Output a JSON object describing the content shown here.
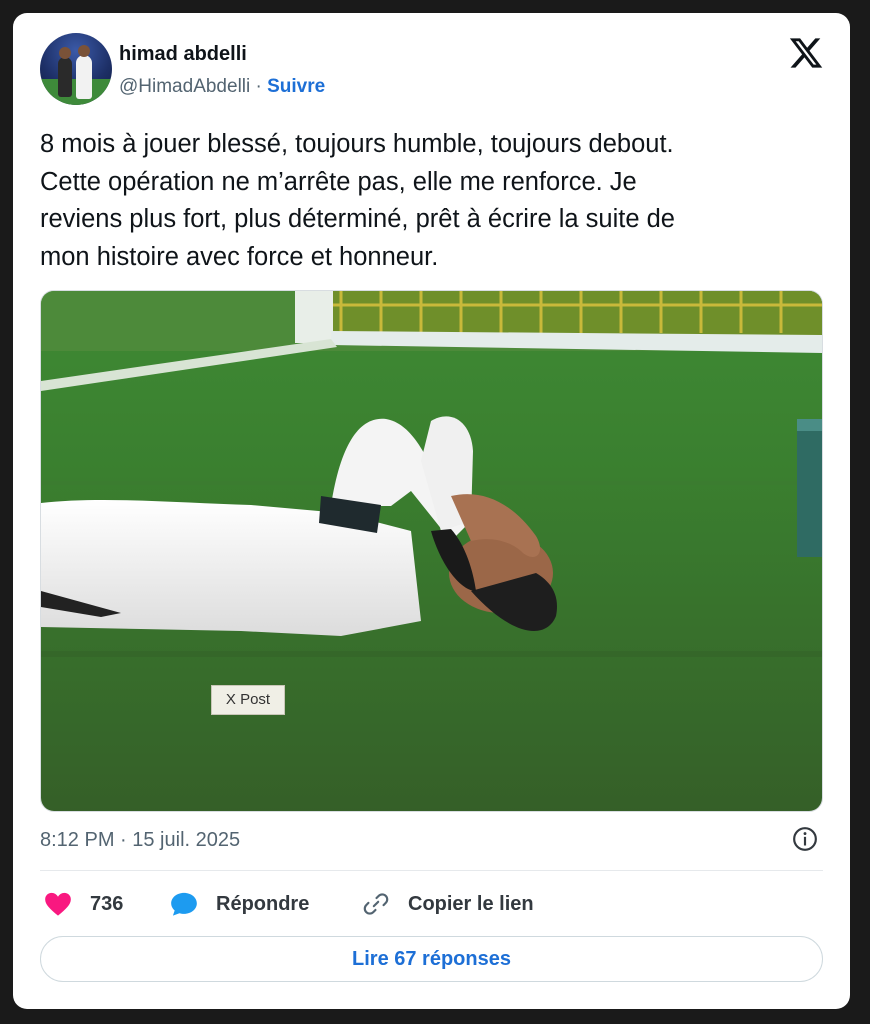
{
  "author": {
    "name": "himad abdelli",
    "handle": "@HimadAbdelli",
    "separator": "·",
    "follow_label": "Suivre"
  },
  "tweet": {
    "lines": [
      "8 mois à jouer blessé, toujours humble, toujours debout.",
      "Cette opération ne m’arrête pas, elle me renforce. Je",
      "reviens plus fort, plus déterminé, prêt à écrire la suite de",
      "mon histoire avec force et honneur."
    ]
  },
  "media": {
    "overlay_tag": "X Post"
  },
  "meta": {
    "timestamp": "8:12 PM · 15 juil. 2025"
  },
  "actions": {
    "like_count": "736",
    "reply_label": "Répondre",
    "copy_link_label": "Copier le lien"
  },
  "footer": {
    "read_replies_label": "Lire 67 réponses"
  },
  "icons": {
    "logo": "x-logo-icon",
    "info": "info-icon",
    "like": "heart-icon",
    "reply": "speech-bubble-icon",
    "copy": "link-icon"
  },
  "colors": {
    "accent": "#1d6fd6",
    "like": "#f91880",
    "reply": "#1d9bf0",
    "text": "#0f1419",
    "muted": "#536471"
  }
}
